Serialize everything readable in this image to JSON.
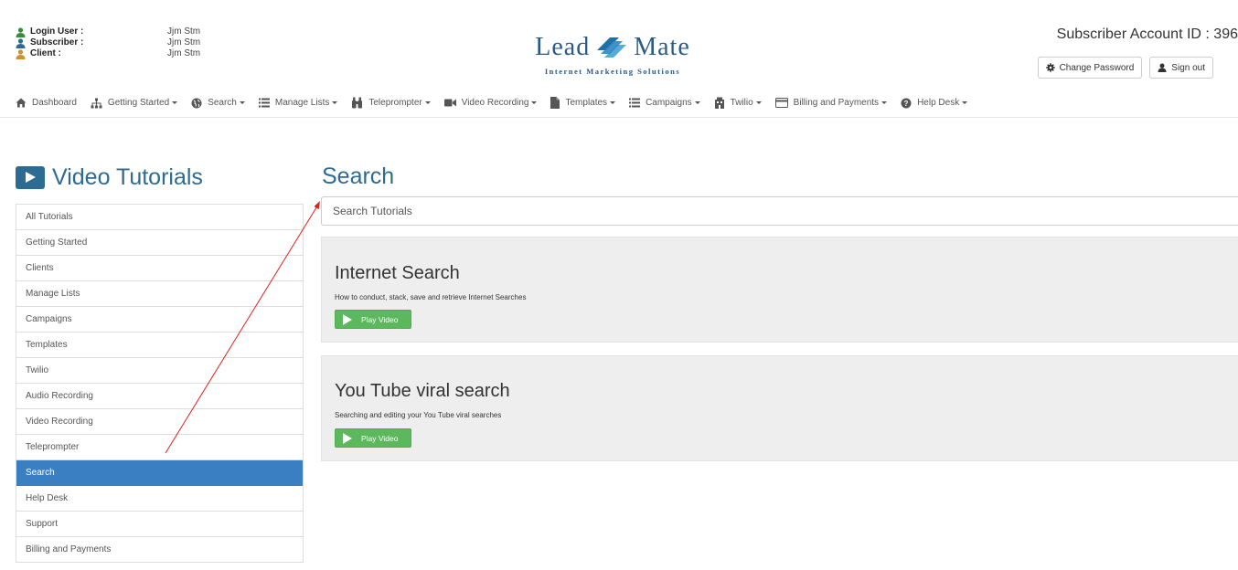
{
  "user": {
    "rows": [
      {
        "label": "Login User :",
        "value": "Jjm Stm",
        "color": "#3c8a3c"
      },
      {
        "label": "Subscriber :",
        "value": "Jjm Stm",
        "color": "#2e6b92"
      },
      {
        "label": "Client :",
        "value": "Jjm Stm",
        "color": "#c9923a"
      }
    ]
  },
  "logo": {
    "lead": "Lead",
    "mate": "Mate",
    "tagline": "Internet Marketing Solutions"
  },
  "account": {
    "id_label": "Subscriber Account ID : 396",
    "change_password": "Change Password",
    "sign_out": "Sign out"
  },
  "nav": [
    {
      "label": "Dashboard",
      "icon": "home-icon",
      "caret": false
    },
    {
      "label": "Getting Started",
      "icon": "sitemap-icon",
      "caret": true
    },
    {
      "label": "Search",
      "icon": "globe-icon",
      "caret": true
    },
    {
      "label": "Manage Lists",
      "icon": "list-icon",
      "caret": true
    },
    {
      "label": "Teleprompter",
      "icon": "binoculars-icon",
      "caret": true
    },
    {
      "label": "Video Recording",
      "icon": "video-camera-icon",
      "caret": true
    },
    {
      "label": "Templates",
      "icon": "file-icon",
      "caret": true
    },
    {
      "label": "Campaigns",
      "icon": "list-icon",
      "caret": true
    },
    {
      "label": "Twilio",
      "icon": "building-icon",
      "caret": true
    },
    {
      "label": "Billing and Payments",
      "icon": "credit-card-icon",
      "caret": true
    },
    {
      "label": "Help Desk",
      "icon": "question-circle-icon",
      "caret": true
    }
  ],
  "sidebar": {
    "title": "Video Tutorials",
    "items": [
      {
        "label": "All Tutorials"
      },
      {
        "label": "Getting Started"
      },
      {
        "label": "Clients"
      },
      {
        "label": "Manage Lists"
      },
      {
        "label": "Campaigns"
      },
      {
        "label": "Templates"
      },
      {
        "label": "Twilio"
      },
      {
        "label": "Audio Recording"
      },
      {
        "label": "Video Recording"
      },
      {
        "label": "Teleprompter"
      },
      {
        "label": "Search"
      },
      {
        "label": "Help Desk"
      },
      {
        "label": "Support"
      },
      {
        "label": "Billing and Payments"
      }
    ],
    "active_index": 10
  },
  "main": {
    "title": "Search",
    "search_placeholder": "Search Tutorials",
    "cards": [
      {
        "title": "Internet Search",
        "desc": "How to conduct, stack, save and retrieve Internet Searches",
        "button": "Play Video"
      },
      {
        "title": "You Tube viral search",
        "desc": "Searching and editing your You Tube viral searches",
        "button": "Play Video"
      }
    ]
  },
  "colors": {
    "brand": "#2e6b92",
    "active": "#3a7fc1",
    "play": "#5cb85c",
    "annotation_arrow": "#e0201c"
  }
}
